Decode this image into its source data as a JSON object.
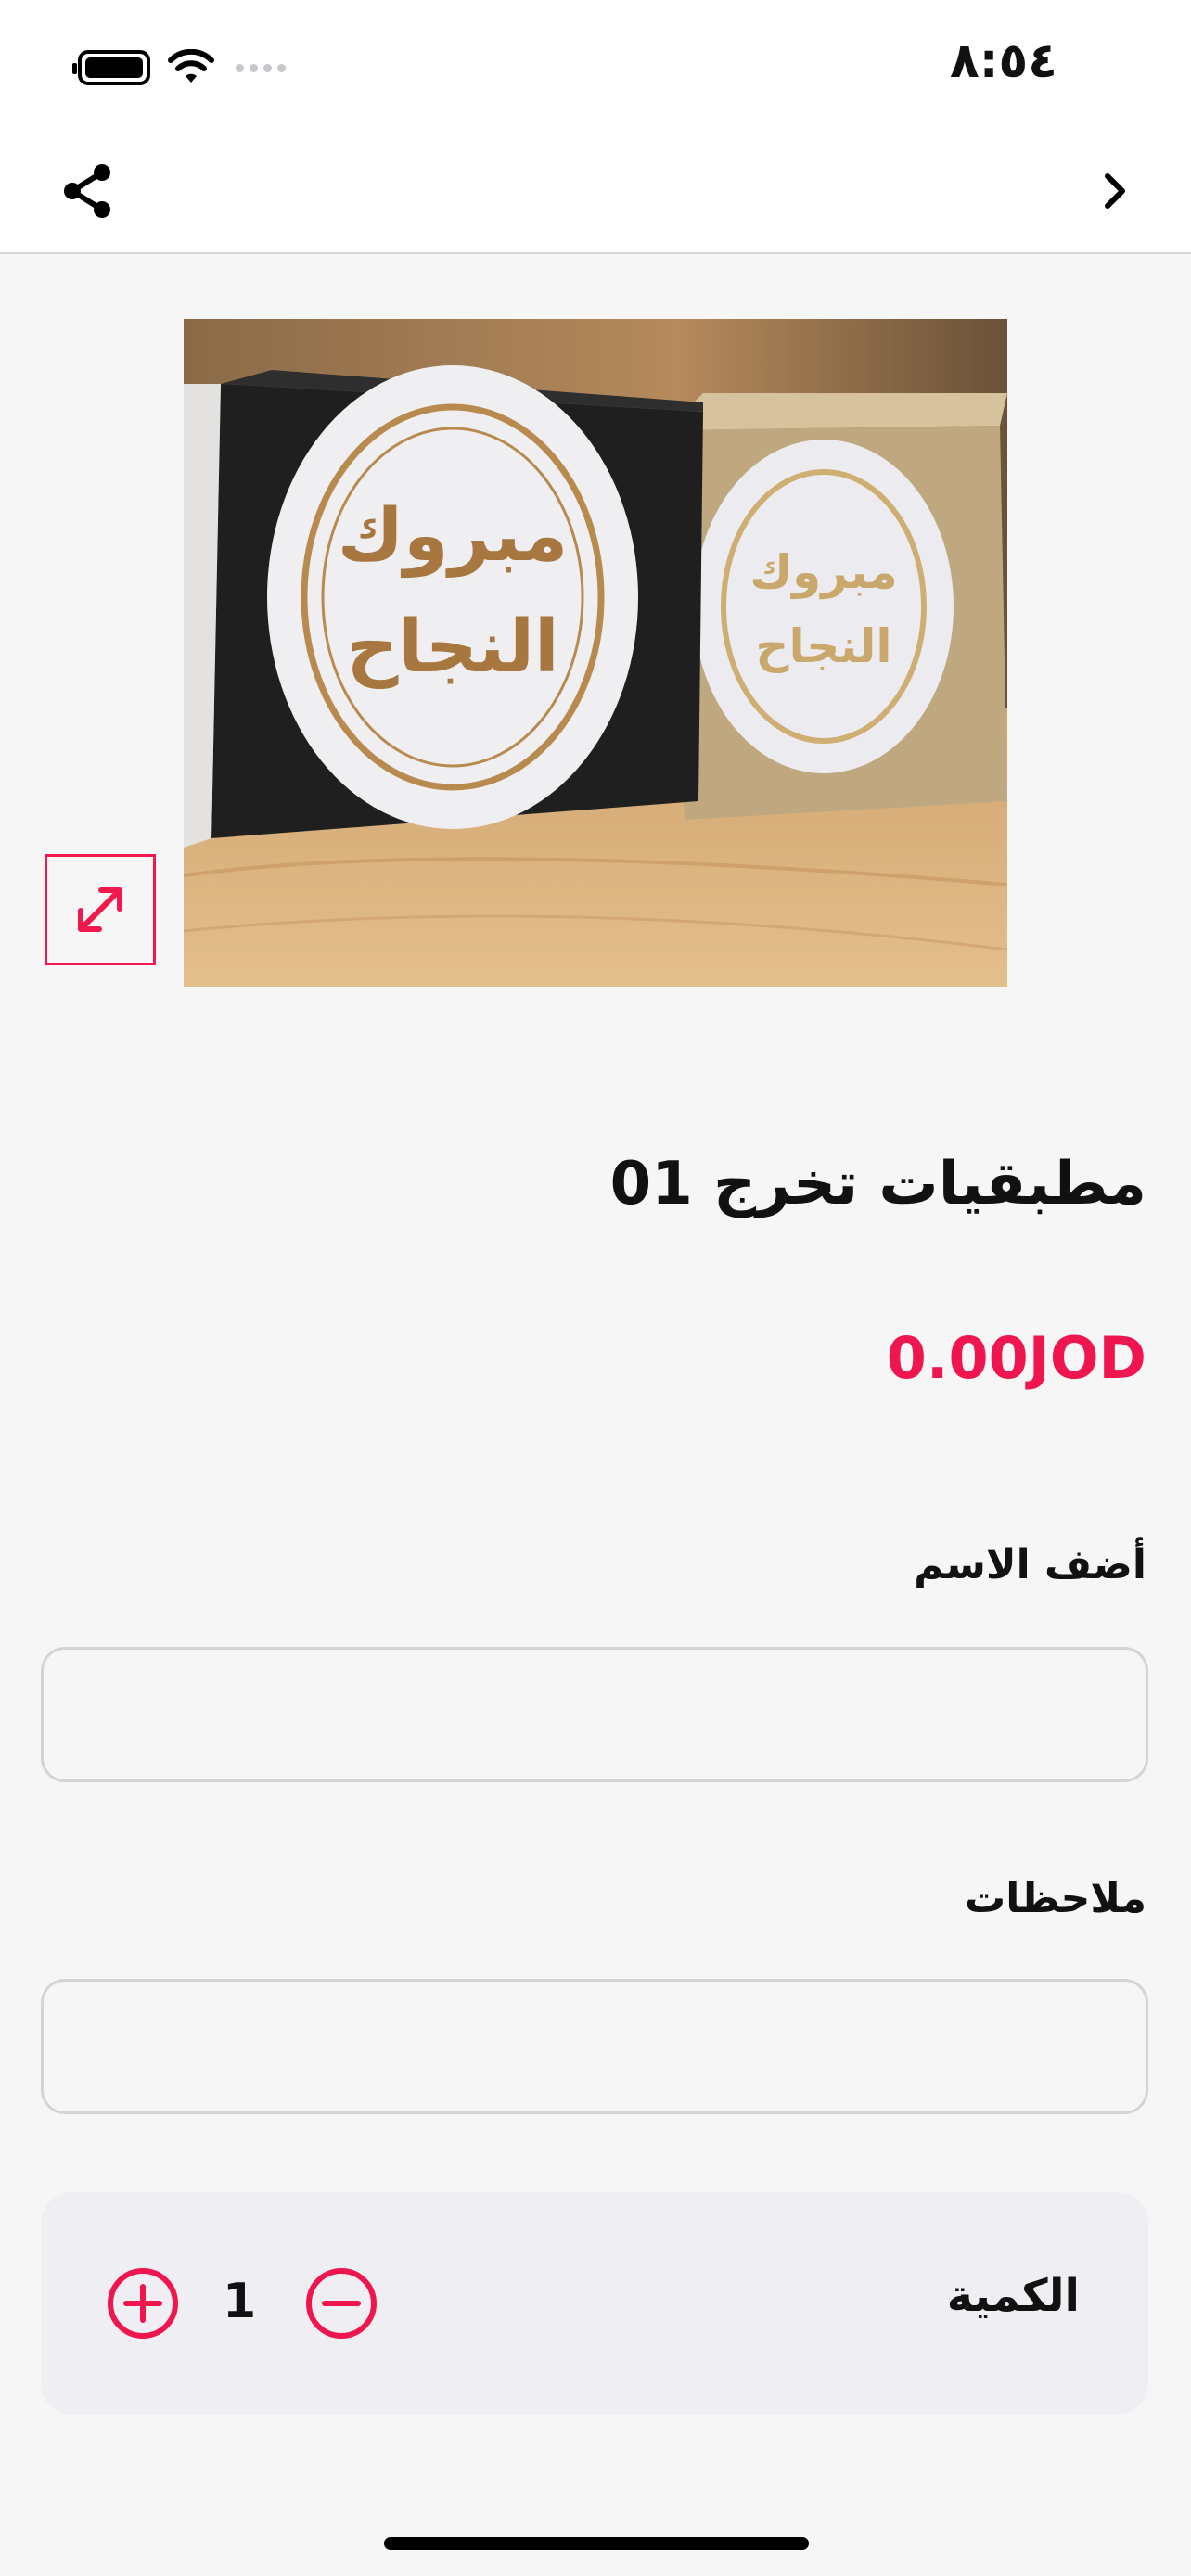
{
  "status_bar": {
    "time": "٨:٥٤"
  },
  "product": {
    "image_texts": [
      "مبروك",
      "النجاح"
    ],
    "title": "مطبقيات تخرج 01",
    "price": "0.00JOD"
  },
  "form": {
    "name_label": "أضف الاسم",
    "name_value": "",
    "notes_label": "ملاحظات",
    "notes_value": ""
  },
  "quantity": {
    "label": "الكمية",
    "value": "1"
  },
  "colors": {
    "accent": "#ef1650",
    "background": "#f6f6f7",
    "card": "#efeff3"
  },
  "icons": {
    "share": "share-icon",
    "back": "chevron-right-icon",
    "expand": "expand-icon",
    "plus": "plus-circle-icon",
    "minus": "minus-circle-icon"
  }
}
